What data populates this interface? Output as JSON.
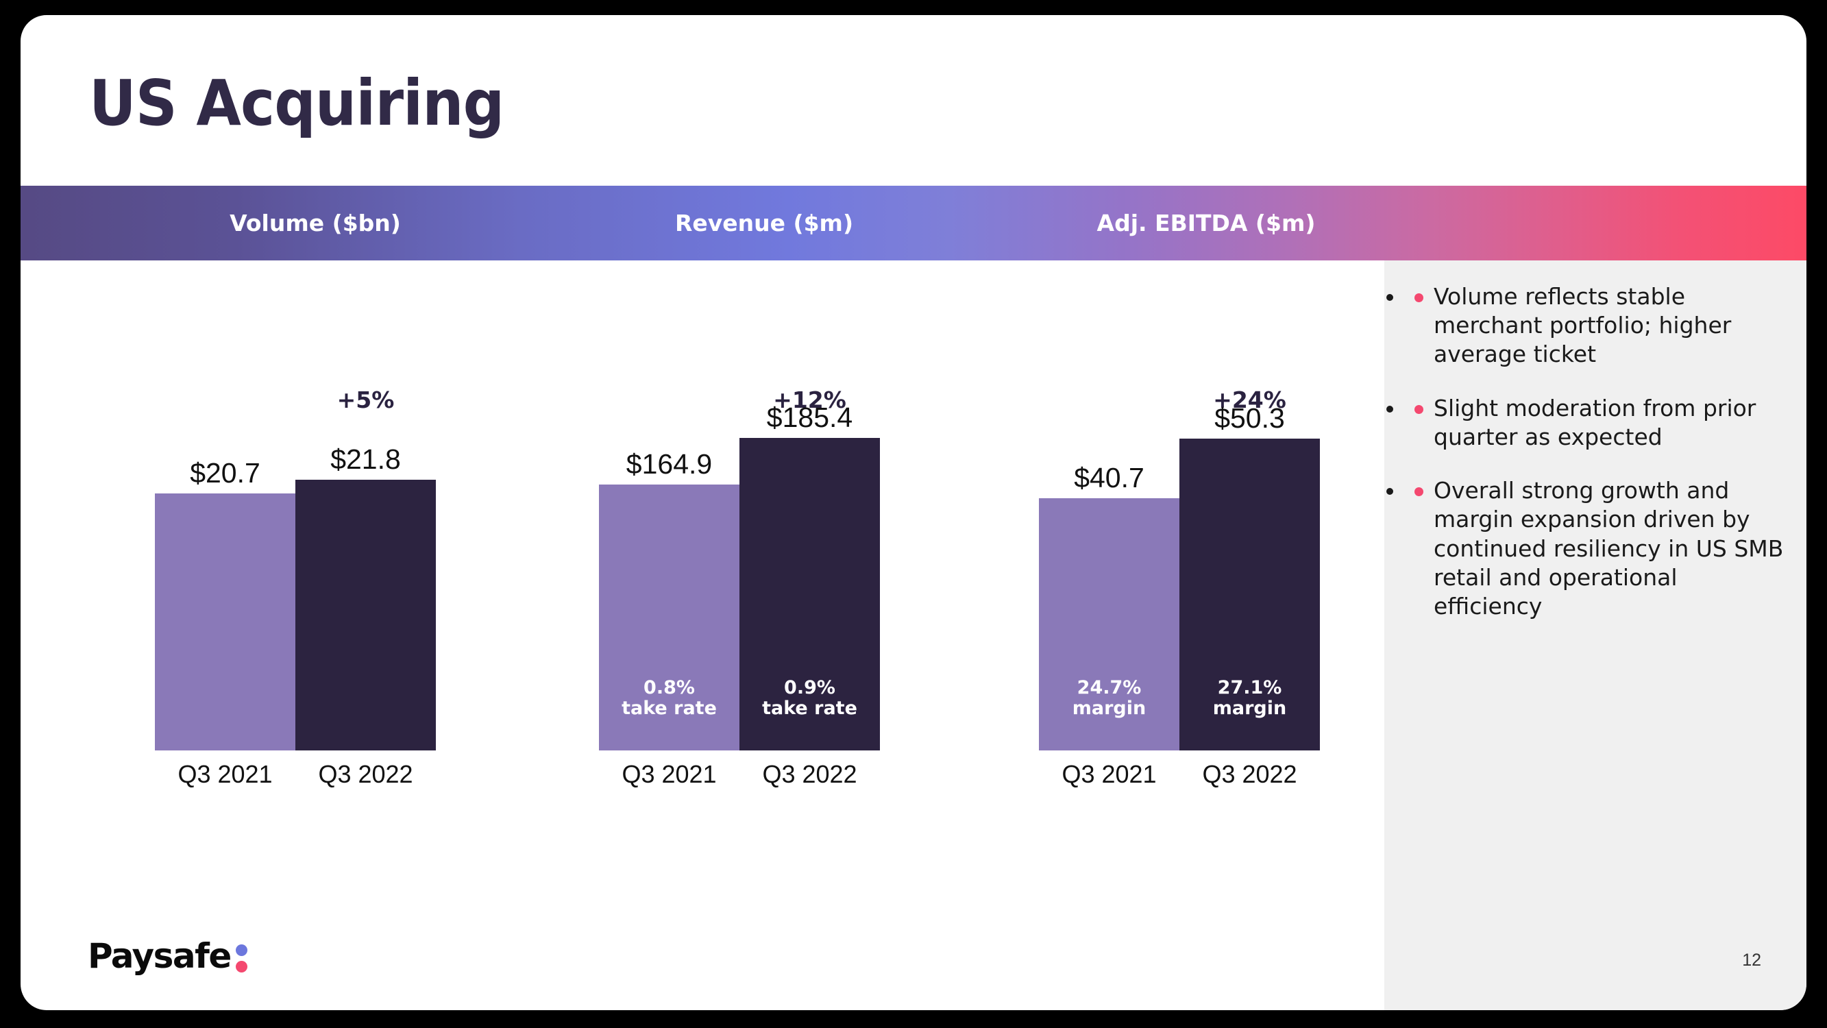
{
  "slide": {
    "title": "US Acquiring",
    "page_number": "12",
    "logo_text": "Paysafe",
    "accent_pink": "#f4486f",
    "accent_blue": "#6c77dd",
    "sidebar_bg": "#f0f0f0",
    "band_gradient_start": "#564a84",
    "band_gradient_mid": "#7179dd",
    "band_gradient_end": "#fd4a66",
    "bar_light_color": "#8a79b8",
    "bar_dark_color": "#2c2340"
  },
  "band": {
    "labels": [
      "Volume ($bn)",
      "Revenue ($m)",
      "Adj. EBITDA ($m)"
    ]
  },
  "commentary": {
    "bullets": [
      "Volume reflects stable merchant portfolio; higher average ticket",
      "Slight moderation from prior quarter as expected",
      "Overall strong growth and margin expansion driven by continued resiliency in US SMB retail and operational efficiency"
    ]
  },
  "chart_data": [
    {
      "type": "bar",
      "title": "Volume ($bn)",
      "categories": [
        "Q3 2021",
        "Q3 2022"
      ],
      "values": [
        20.7,
        21.8
      ],
      "value_labels": [
        "$20.7",
        "$21.8"
      ],
      "bar_sublabels": [
        "",
        ""
      ],
      "growth_label": "+5%",
      "bar_colors": [
        "#8a79b8",
        "#2c2340"
      ],
      "ylim": [
        0,
        25
      ],
      "grid": false,
      "legend": "none",
      "xlabel": "",
      "ylabel": "Volume ($bn)"
    },
    {
      "type": "bar",
      "title": "Revenue ($m)",
      "categories": [
        "Q3 2021",
        "Q3 2022"
      ],
      "values": [
        164.9,
        185.4
      ],
      "value_labels": [
        "$164.9",
        "$185.4"
      ],
      "bar_sublabels": [
        "0.8%\ntake rate",
        "0.9%\ntake rate"
      ],
      "growth_label": "+12%",
      "bar_colors": [
        "#8a79b8",
        "#2c2340"
      ],
      "ylim": [
        0,
        210
      ],
      "grid": false,
      "legend": "none",
      "xlabel": "",
      "ylabel": "Revenue ($m)"
    },
    {
      "type": "bar",
      "title": "Adj. EBITDA ($m)",
      "categories": [
        "Q3 2021",
        "Q3 2022"
      ],
      "values": [
        40.7,
        50.3
      ],
      "value_labels": [
        "$40.7",
        "$50.3"
      ],
      "bar_sublabels": [
        "24.7%\nmargin",
        "27.1%\nmargin"
      ],
      "growth_label": "+24%",
      "bar_colors": [
        "#8a79b8",
        "#2c2340"
      ],
      "ylim": [
        0,
        57
      ],
      "grid": false,
      "legend": "none",
      "xlabel": "",
      "ylabel": "Adj. EBITDA ($m)"
    }
  ]
}
